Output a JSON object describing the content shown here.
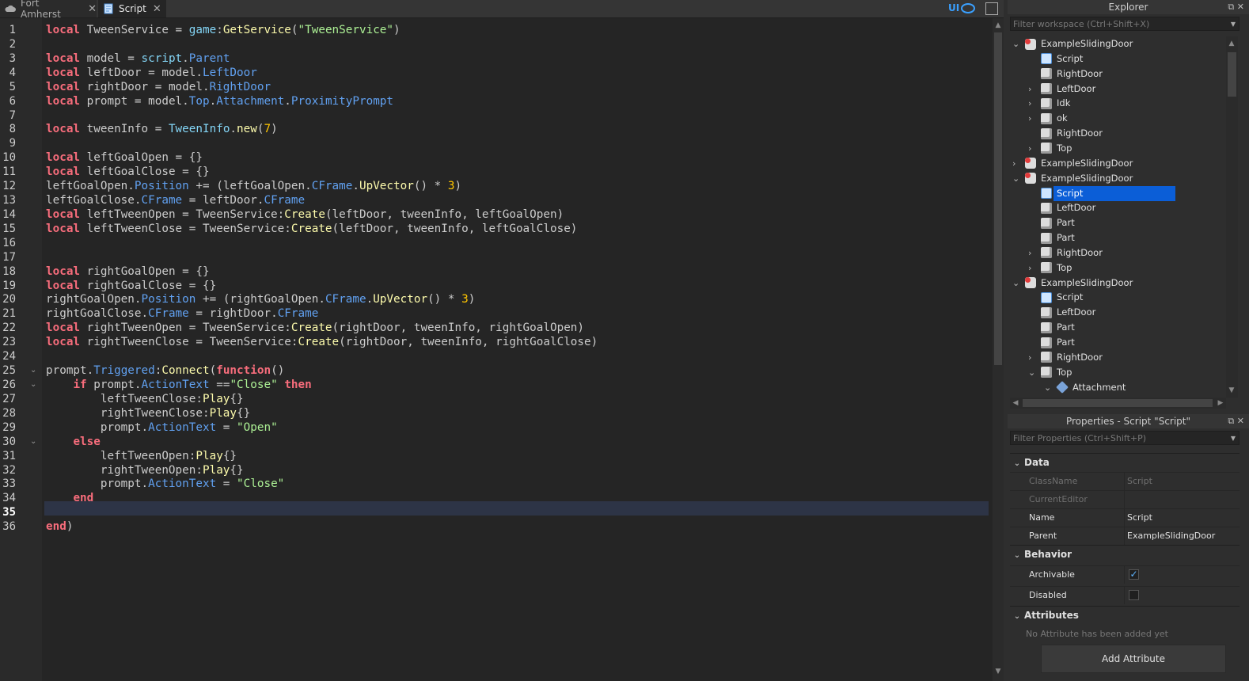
{
  "tabs": [
    {
      "label": "Fort Amherst",
      "icon": "cloud-icon"
    },
    {
      "label": "Script",
      "icon": "script-icon"
    }
  ],
  "toolbar": {
    "ui_label": "UI"
  },
  "editor": {
    "current_line": 35,
    "lines": [
      "local TweenService = game:GetService(\"TweenService\")",
      "",
      "local model = script.Parent",
      "local leftDoor = model.LeftDoor",
      "local rightDoor = model.RightDoor",
      "local prompt = model.Top.Attachment.ProximityPrompt",
      "",
      "local tweenInfo = TweenInfo.new(7)",
      "",
      "local leftGoalOpen = {}",
      "local leftGoalClose = {}",
      "leftGoalOpen.Position += (leftGoalOpen.CFrame.UpVector() * 3)",
      "leftGoalClose.CFrame = leftDoor.CFrame",
      "local leftTweenOpen = TweenService:Create(leftDoor, tweenInfo, leftGoalOpen)",
      "local leftTweenClose = TweenService:Create(leftDoor, tweenInfo, leftGoalClose)",
      "",
      "",
      "local rightGoalOpen = {}",
      "local rightGoalClose = {}",
      "rightGoalOpen.Position += (rightGoalOpen.CFrame.UpVector() * 3)",
      "rightGoalClose.CFrame = rightDoor.CFrame",
      "local rightTweenOpen = TweenService:Create(rightDoor, tweenInfo, rightGoalOpen)",
      "local rightTweenClose = TweenService:Create(rightDoor, tweenInfo, rightGoalClose)",
      "",
      "prompt.Triggered:Connect(function()",
      "    if prompt.ActionText ==\"Close\" then",
      "        leftTweenClose:Play{}",
      "        rightTweenClose:Play{}",
      "        prompt.ActionText = \"Open\"",
      "    else",
      "        leftTweenOpen:Play{}",
      "        rightTweenOpen:Play{}",
      "        prompt.ActionText = \"Close\"",
      "    end",
      "",
      "end)"
    ]
  },
  "explorer": {
    "title": "Explorer",
    "filter_placeholder": "Filter workspace (Ctrl+Shift+X)",
    "items": [
      {
        "label": "ExampleSlidingDoor",
        "depth": 0,
        "icon": "model",
        "chevron": "down"
      },
      {
        "label": "Script",
        "depth": 1,
        "icon": "script",
        "chevron": ""
      },
      {
        "label": "RightDoor",
        "depth": 1,
        "icon": "part",
        "chevron": ""
      },
      {
        "label": "LeftDoor",
        "depth": 1,
        "icon": "part",
        "chevron": "right"
      },
      {
        "label": "Idk",
        "depth": 1,
        "icon": "part",
        "chevron": "right"
      },
      {
        "label": "ok",
        "depth": 1,
        "icon": "part",
        "chevron": "right"
      },
      {
        "label": "RightDoor",
        "depth": 1,
        "icon": "part",
        "chevron": ""
      },
      {
        "label": "Top",
        "depth": 1,
        "icon": "part",
        "chevron": "right"
      },
      {
        "label": "ExampleSlidingDoor",
        "depth": 0,
        "icon": "model",
        "chevron": "right"
      },
      {
        "label": "ExampleSlidingDoor",
        "depth": 0,
        "icon": "model",
        "chevron": "down"
      },
      {
        "label": "Script",
        "depth": 1,
        "icon": "script",
        "chevron": "",
        "selected": true
      },
      {
        "label": "LeftDoor",
        "depth": 1,
        "icon": "part",
        "chevron": ""
      },
      {
        "label": "Part",
        "depth": 1,
        "icon": "part",
        "chevron": ""
      },
      {
        "label": "Part",
        "depth": 1,
        "icon": "part",
        "chevron": ""
      },
      {
        "label": "RightDoor",
        "depth": 1,
        "icon": "part",
        "chevron": "right"
      },
      {
        "label": "Top",
        "depth": 1,
        "icon": "part",
        "chevron": "right"
      },
      {
        "label": "ExampleSlidingDoor",
        "depth": 0,
        "icon": "model",
        "chevron": "down"
      },
      {
        "label": "Script",
        "depth": 1,
        "icon": "script",
        "chevron": ""
      },
      {
        "label": "LeftDoor",
        "depth": 1,
        "icon": "part",
        "chevron": ""
      },
      {
        "label": "Part",
        "depth": 1,
        "icon": "part",
        "chevron": ""
      },
      {
        "label": "Part",
        "depth": 1,
        "icon": "part",
        "chevron": ""
      },
      {
        "label": "RightDoor",
        "depth": 1,
        "icon": "part",
        "chevron": "right"
      },
      {
        "label": "Top",
        "depth": 1,
        "icon": "part",
        "chevron": "down"
      },
      {
        "label": "Attachment",
        "depth": 2,
        "icon": "attachment",
        "chevron": "down"
      }
    ]
  },
  "properties": {
    "title": "Properties - Script \"Script\"",
    "filter_placeholder": "Filter Properties (Ctrl+Shift+P)",
    "sections": {
      "data": "Data",
      "behavior": "Behavior",
      "attributes": "Attributes"
    },
    "rows": {
      "classname": {
        "name": "ClassName",
        "value": "Script"
      },
      "currenteditor": {
        "name": "CurrentEditor",
        "value": ""
      },
      "name": {
        "name": "Name",
        "value": "Script"
      },
      "parent": {
        "name": "Parent",
        "value": "ExampleSlidingDoor"
      },
      "archivable": {
        "name": "Archivable",
        "checked": true
      },
      "disabled": {
        "name": "Disabled",
        "checked": false
      }
    },
    "no_attribute_text": "No Attribute has been added yet",
    "add_attribute_label": "Add Attribute"
  },
  "colors": {
    "keyword": "#f86d7c",
    "function": "#fdfbac",
    "property": "#61a1f1",
    "string": "#adf195",
    "number": "#ffc600",
    "selection": "#0b5ed7"
  }
}
